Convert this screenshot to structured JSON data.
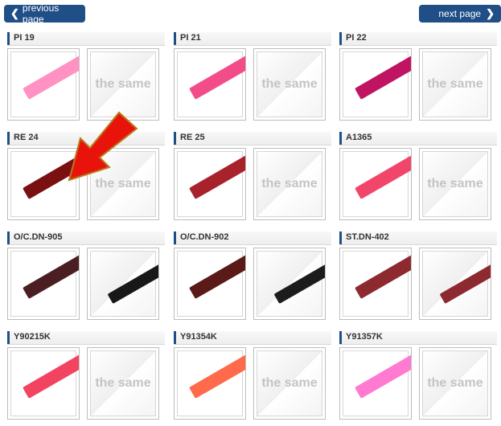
{
  "nav": {
    "prev_label": "previous page",
    "next_label": "next page"
  },
  "same_text": "the same",
  "colors": {
    "nav": "#1f4f86",
    "arrow": "#e8140c"
  },
  "rows": [
    [
      {
        "name": "PI 19",
        "color": "#ff92c2",
        "variant": "same"
      },
      {
        "name": "PI 21",
        "color": "#f24d88",
        "variant": "same"
      },
      {
        "name": "PI 22",
        "color": "#c01463",
        "variant": "same"
      }
    ],
    [
      {
        "name": "RE 24",
        "color": "#7a1010",
        "variant": "same"
      },
      {
        "name": "RE 25",
        "color": "#a8222c",
        "variant": "same"
      },
      {
        "name": "A1365",
        "color": "#f1466a",
        "variant": "same"
      }
    ],
    [
      {
        "name": "O/C.DN-905",
        "color": "#4a1e22",
        "variant": "dark",
        "variant_color": "#181818"
      },
      {
        "name": "O/C.DN-902",
        "color": "#5a1a18",
        "variant": "dark",
        "variant_color": "#1c1c1c"
      },
      {
        "name": "ST.DN-402",
        "color": "#8c2a30",
        "variant": "dark",
        "variant_color": "#8c2a30"
      }
    ],
    [
      {
        "name": "Y90215K",
        "color": "#f24460",
        "variant": "same"
      },
      {
        "name": "Y91354K",
        "color": "#ff6a4a",
        "variant": "same"
      },
      {
        "name": "Y91357K",
        "color": "#ff7ad0",
        "variant": "same"
      }
    ]
  ]
}
